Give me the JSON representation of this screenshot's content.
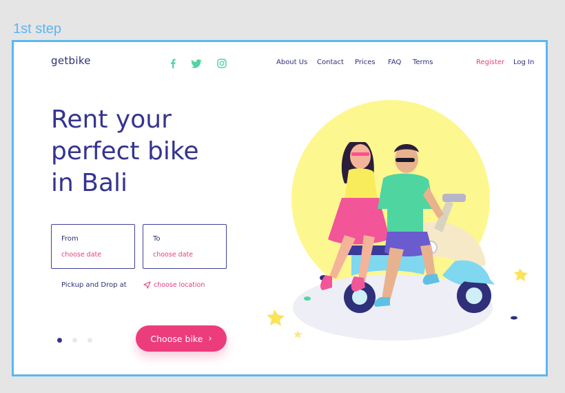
{
  "annotation": {
    "step_label": "1st step"
  },
  "brand": {
    "logo": "getbike"
  },
  "social": [
    {
      "name": "facebook-icon",
      "color": "#4fd5a0"
    },
    {
      "name": "twitter-icon",
      "color": "#4fd5a0"
    },
    {
      "name": "instagram-icon",
      "color": "#4fd5a0"
    }
  ],
  "nav": {
    "about": "About Us",
    "contact": "Contact",
    "prices": "Prices",
    "faq": "FAQ",
    "terms": "Terms"
  },
  "auth": {
    "register": "Register",
    "login": "Log In"
  },
  "hero": {
    "line1": "Rent your",
    "line2": "perfect bike",
    "line3": "in Bali"
  },
  "booking": {
    "from_label": "From",
    "from_value": "choose date",
    "to_label": "To",
    "to_value": "choose date",
    "pickup_label": "Pickup and Drop at",
    "location_value": "choose location"
  },
  "slider": {
    "count": 3,
    "active": 1
  },
  "cta": {
    "label": "Choose bike"
  },
  "colors": {
    "primary": "#353490",
    "accent": "#e73c7e",
    "social": "#4fd5a0",
    "sun": "#fdf78f",
    "annotation": "#5bb6f0"
  }
}
